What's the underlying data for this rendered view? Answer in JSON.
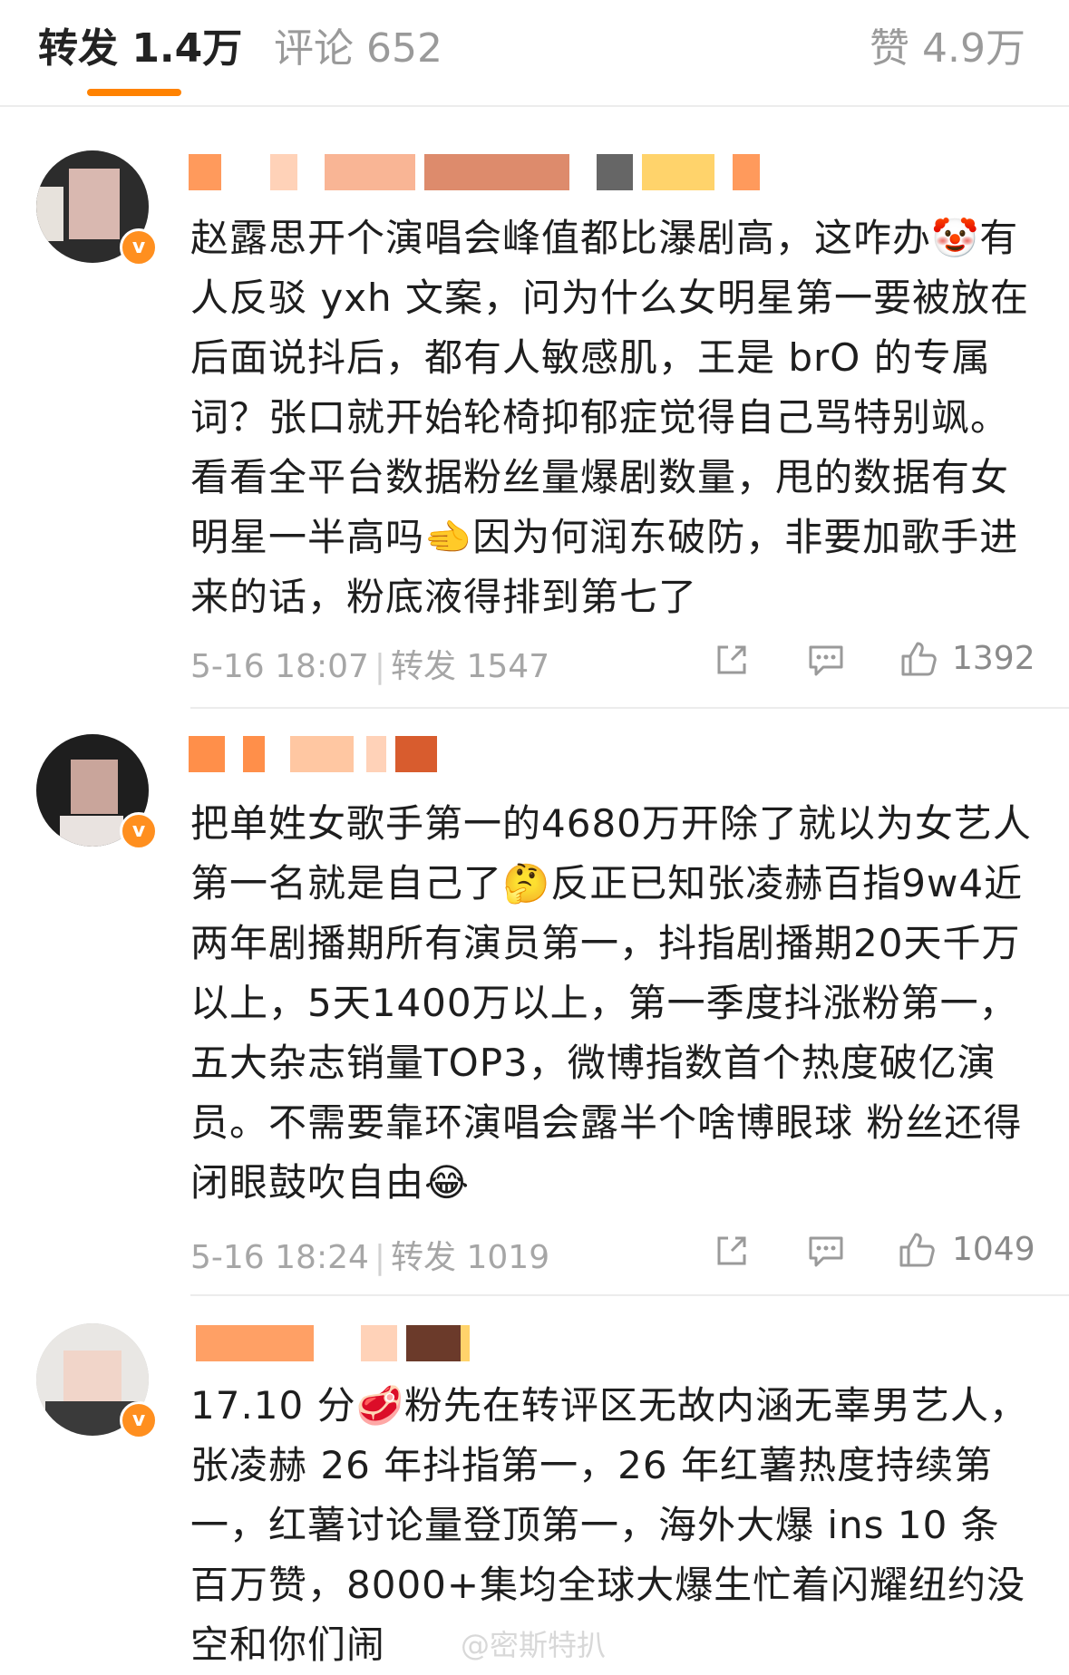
{
  "tabs": {
    "repost_label": "转发 1.4万",
    "comment_label": "评论 652",
    "like_label": "赞 4.9万"
  },
  "accent_color": "#ff8200",
  "comments": [
    {
      "text": "赵露思开个演唱会峰值都比瀑剧高，这咋办🤡有人反驳 yxh 文案，问为什么女明星第一要被放在后面说抖后，都有人敏感肌，王是 brO 的专属词？张口就开始轮椅抑郁症觉得自己骂特别飒。看看全平台数据粉丝量爆剧数量，甩的数据有女明星一半高吗🫲因为何润东破防，非要加歌手进来的话，粉底液得排到第七了",
      "time": "5-16 18:07",
      "repost": "转发 1547",
      "likes": "1392"
    },
    {
      "text": "把单姓女歌手第一的4680万开除了就以为女艺人第一名就是自己了🤔反正已知张凌赫百指9w4近两年剧播期所有演员第一，抖指剧播期20天千万以上，5天1400万以上，第一季度抖涨粉第一，五大杂志销量TOP3，微博指数首个热度破亿演员。不需要靠环演唱会露半个啥博眼球 粉丝还得闭眼鼓吹自由😂",
      "time": "5-16 18:24",
      "repost": "转发 1019",
      "likes": "1049"
    },
    {
      "text": "17.10 分🥩粉先在转评区无故内涵无辜男艺人，张凌赫 26 年抖指第一，26 年红薯热度持续第一，红薯讨论量登顶第一，海外大爆 ins 10 条百万赞，8000+集均全球大爆生忙着闪耀纽约没空和你们闹"
    }
  ],
  "watermark": "@密斯特扒",
  "icons": [
    "share-icon",
    "comment-icon",
    "thumbs-up-icon",
    "verified-badge-icon"
  ]
}
